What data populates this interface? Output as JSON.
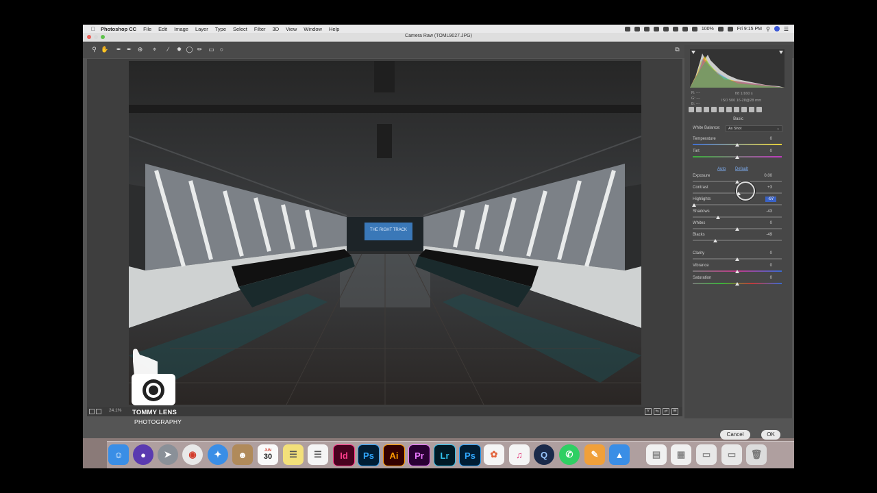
{
  "menubar": {
    "app_name": "Photoshop CC",
    "menus": [
      "File",
      "Edit",
      "Image",
      "Layer",
      "Type",
      "Select",
      "Filter",
      "3D",
      "View",
      "Window",
      "Help"
    ],
    "battery": "100%",
    "clock": "Fri 9:15 PM"
  },
  "window": {
    "title": "Camera Raw (TOML9027.JPG)"
  },
  "toolbar": {
    "tools": [
      "zoom-tool",
      "hand-tool",
      "white-balance-tool",
      "color-sampler-tool",
      "targeted-adjustment-tool",
      "crop-tool",
      "straighten-tool",
      "spot-removal-tool",
      "red-eye-tool",
      "adjustment-brush-tool",
      "graduated-filter-tool",
      "radial-filter-tool"
    ]
  },
  "photo": {
    "sign_text": "THE RIGHT TRACK"
  },
  "statusbar": {
    "zoom": "24.1%"
  },
  "watermark": {
    "name": "TOMMY LENS",
    "sub": "PHOTOGRAPHY"
  },
  "panel": {
    "readout": {
      "r": "R:  ---",
      "g": "G:  ---",
      "b": "B:  ---",
      "aperture_shutter": "f/8    1/160 s",
      "iso_lens": "ISO 500    16-28@28 mm"
    },
    "section_title": "Basic",
    "white_balance_label": "White Balance:",
    "white_balance_value": "As Shot",
    "auto_label": "Auto",
    "default_label": "Default",
    "sliders": [
      {
        "label": "Temperature",
        "value": "0"
      },
      {
        "label": "Tint",
        "value": "0"
      },
      {
        "label": "Exposure",
        "value": "0.00"
      },
      {
        "label": "Contrast",
        "value": "+3"
      },
      {
        "label": "Highlights",
        "value": "-97"
      },
      {
        "label": "Shadows",
        "value": "-43"
      },
      {
        "label": "Whites",
        "value": "0"
      },
      {
        "label": "Blacks",
        "value": "-49"
      },
      {
        "label": "Clarity",
        "value": "0"
      },
      {
        "label": "Vibrance",
        "value": "0"
      },
      {
        "label": "Saturation",
        "value": "0"
      }
    ]
  },
  "buttons": {
    "cancel": "Cancel",
    "ok": "OK"
  },
  "dock": {
    "calendar_day": "30",
    "calendar_month": "JUN",
    "apps": [
      "finder-icon",
      "siri-icon",
      "launchpad-icon",
      "chrome-icon",
      "safari-icon",
      "contacts-icon",
      "calendar-icon",
      "notes-icon",
      "reminders-icon",
      "indesign-icon",
      "photoshop-icon",
      "illustrator-icon",
      "premiere-icon",
      "lightroom-icon",
      "photoshop-icon-2",
      "photos-icon",
      "itunes-icon",
      "quicktime-icon",
      "whatsapp-icon",
      "pages-icon",
      "keynote-icon",
      "document-icon",
      "spreadsheet-icon",
      "drive-icon",
      "drive-icon-2",
      "trash-icon"
    ],
    "labels": {
      "indesign": "Id",
      "photoshop": "Ps",
      "illustrator": "Ai",
      "premiere": "Pr",
      "lightroom": "Lr"
    }
  },
  "colors": {
    "accent": "#3a62c6",
    "dock_indesign": "#49021f",
    "dock_photoshop": "#001d34",
    "dock_illustrator": "#330000",
    "dock_premiere": "#2a0034",
    "dock_lightroom": "#001a26"
  }
}
